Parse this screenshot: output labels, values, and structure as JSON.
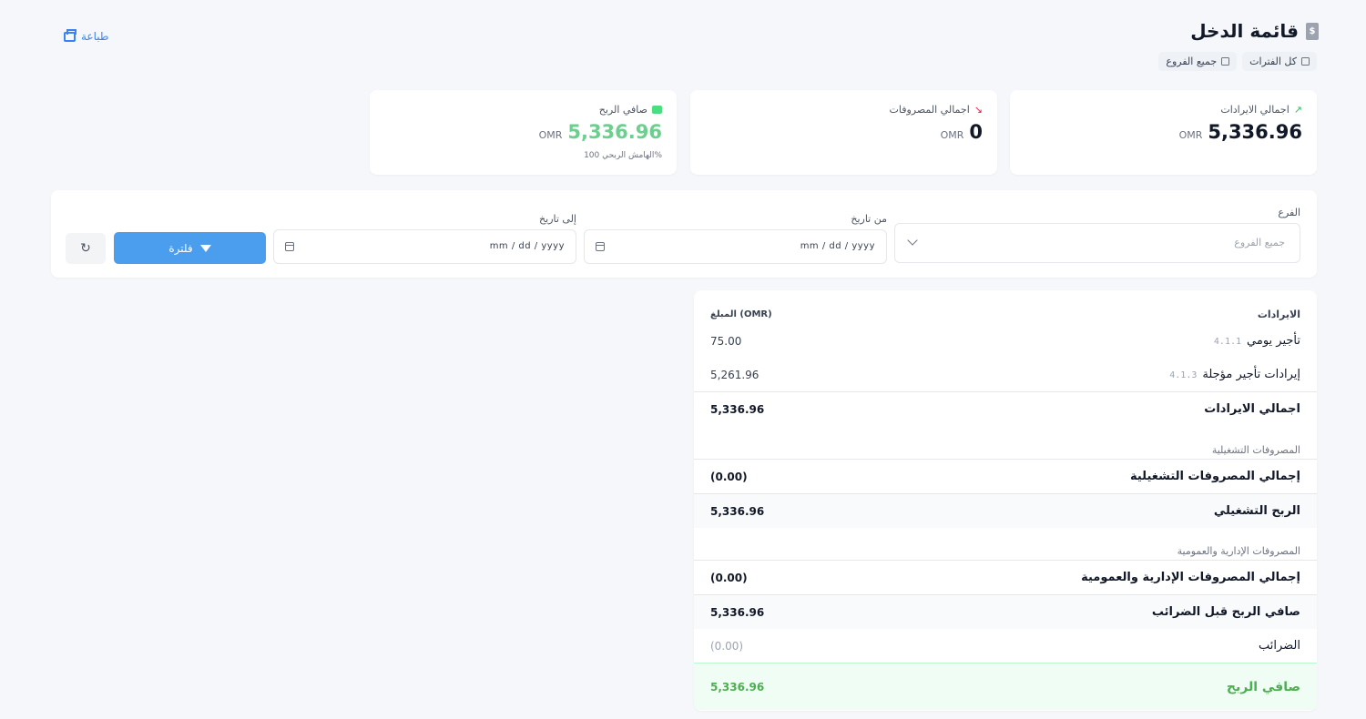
{
  "header": {
    "title": "قائمة الدخل",
    "print_label": "طباعة",
    "chips": {
      "periods": "كل الفترات",
      "branches": "جميع الفروع"
    }
  },
  "stats": {
    "revenue": {
      "label": "اجمالي الايرادات",
      "value": "5,336.96",
      "currency": "OMR"
    },
    "expenses": {
      "label": "اجمالي المصروفات",
      "value": "0",
      "currency": "OMR"
    },
    "net_profit": {
      "label": "صافي الربح",
      "value": "5,336.96",
      "currency": "OMR",
      "note": "الهامش الربحي 100%"
    }
  },
  "filters": {
    "branch_label": "الفرع",
    "branch_placeholder": "جميع الفروع",
    "from_label": "من تاريخ",
    "to_label": "إلى تاريخ",
    "date_placeholder": "mm / dd / yyyy",
    "filter_button": "فلترة"
  },
  "statement": {
    "revenues_header": "الايرادات",
    "amount_header": "المبلغ (OMR)",
    "revenue_items": [
      {
        "code": "4.1.1",
        "name": "تأجير يومي",
        "amount": "75.00"
      },
      {
        "code": "4.1.3",
        "name": "إيرادات تأجير مؤجلة",
        "amount": "5,261.96"
      }
    ],
    "total_revenues": {
      "label": "اجمالي الايرادات",
      "amount": "5,336.96"
    },
    "operating_section": "المصروفات التشغيلية",
    "total_operating": {
      "label": "إجمالي المصروفات التشغيلية",
      "amount": "(0.00)"
    },
    "operating_profit": {
      "label": "الربح التشغيلي",
      "amount": "5,336.96"
    },
    "admin_section": "المصروفات الإدارية والعمومية",
    "total_admin": {
      "label": "إجمالي المصروفات الإدارية والعمومية",
      "amount": "(0.00)"
    },
    "profit_before_tax": {
      "label": "صافي الربح قبل الضرائب",
      "amount": "5,336.96"
    },
    "taxes": {
      "label": "الضرائب",
      "amount": "(0.00)"
    },
    "net_profit": {
      "label": "صافي الربح",
      "amount": "5,336.96"
    }
  },
  "colors": {
    "primary": "#4a9eed",
    "profit_green": "#4caf50",
    "background": "#f5f7fa"
  }
}
